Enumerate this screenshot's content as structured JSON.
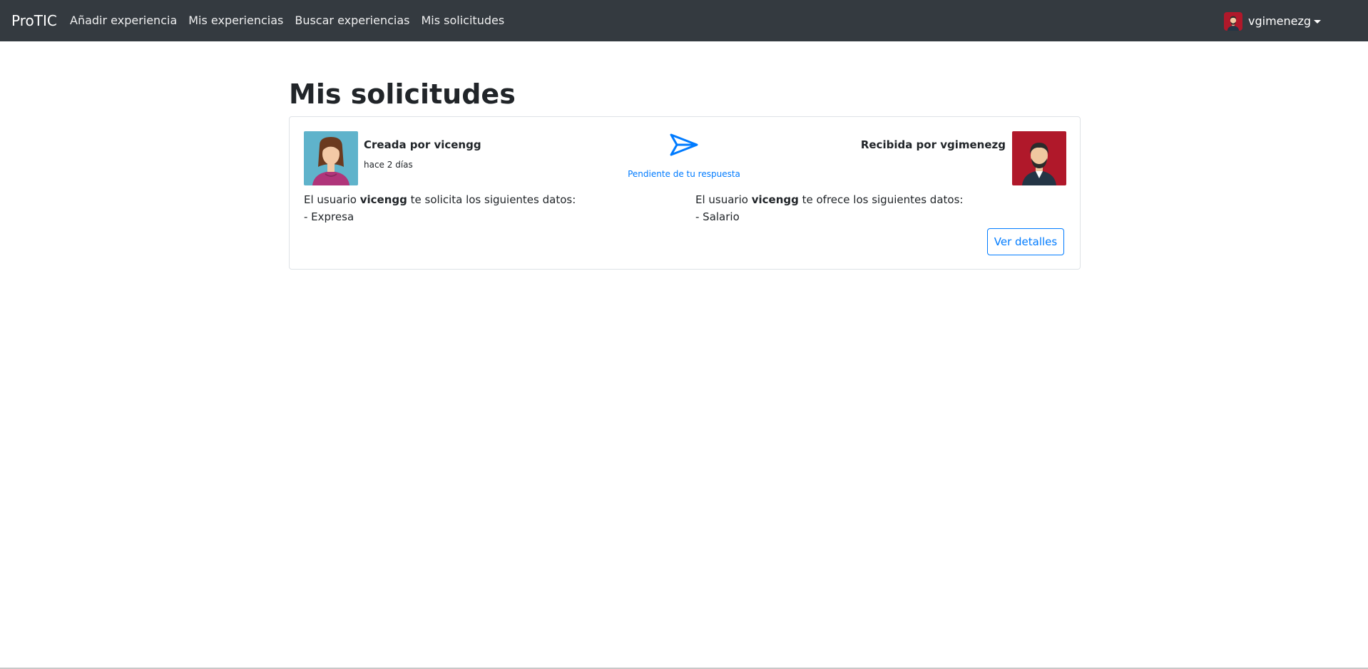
{
  "navbar": {
    "brand": "ProTIC",
    "links": [
      "Añadir experiencia",
      "Mis experiencias",
      "Buscar experiencias",
      "Mis solicitudes"
    ],
    "user": "vgimenezg",
    "background": "#343a40"
  },
  "page": {
    "title": "Mis solicitudes"
  },
  "request": {
    "creator_title": "Creada por vicengg",
    "created_time": "hace 2 días",
    "status": "Pendiente de tu respuesta",
    "receiver_title": "Recibida por vgimenezg",
    "left_prefix": "El usuario ",
    "left_user": "vicengg",
    "left_suffix": " te solicita los siguientes datos:",
    "left_item": "- Expresa",
    "right_prefix": "El usuario ",
    "right_user": "vicengg",
    "right_suffix": " te ofrece los siguientes datos:",
    "right_item": "- Salario",
    "details_button": "Ver detalles",
    "icons": {
      "creator_avatar": "woman-avatar-icon",
      "receiver_avatar": "man-avatar-icon",
      "status": "send-icon"
    },
    "accent": "#007bff"
  }
}
